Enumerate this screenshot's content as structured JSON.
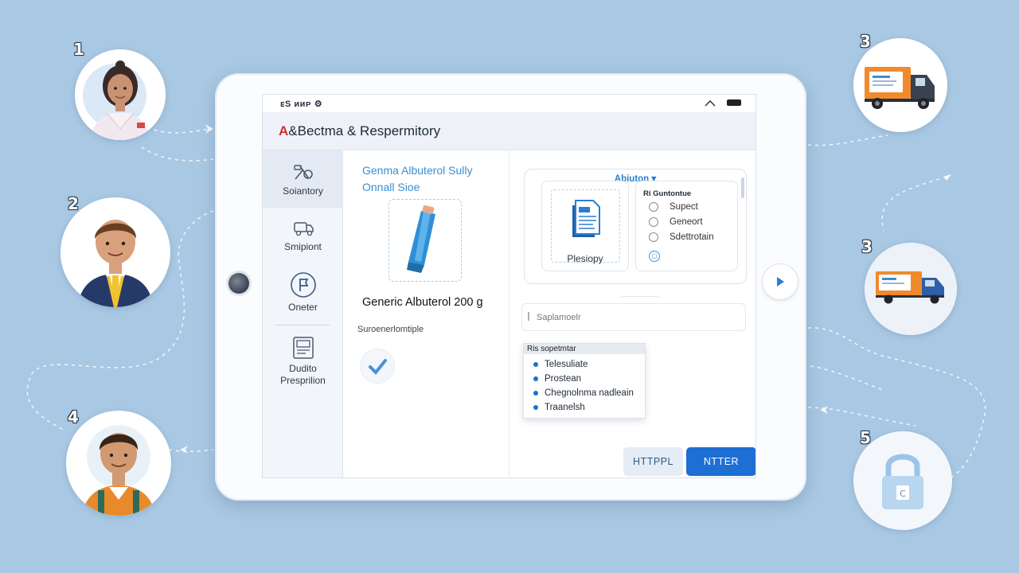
{
  "steps": {
    "s1": "1",
    "s2": "2",
    "s3": "3",
    "s3b": "3",
    "s4": "4",
    "s5": "5"
  },
  "status_bar": {
    "left_text": "ᴇS ᴎᴎᴘ ⚙"
  },
  "app": {
    "title_logo": "A",
    "title_rest": "&Bectma & Respermitory"
  },
  "sidebar": {
    "items": [
      {
        "label": "Soiantory",
        "icon": "tools-icon",
        "active": true
      },
      {
        "label": "Smipiont",
        "icon": "truck-icon"
      },
      {
        "label": "Oneter",
        "icon": "flag-icon"
      },
      {
        "label_line1": "Dudito",
        "label_line2": "Presprilion",
        "icon": "prescription-icon"
      }
    ]
  },
  "product": {
    "subtitle_line1": "Genma Albuterol Sully",
    "subtitle_line2": "Onnall Sioe",
    "name": "Generic Albuterol 200 g",
    "subtext": "Suroenerlomtiple"
  },
  "options": {
    "title": "Abiuton",
    "doc_label": "Plesiopy",
    "radio_header": "Ri Guntontue",
    "radio_items": [
      "Supect",
      "Geneort",
      "Sdettrotain"
    ]
  },
  "search": {
    "placeholder": "Saplamoelr"
  },
  "dropdown": {
    "header": "Ris sopetmtar",
    "items": [
      "Telesuliate",
      "Prostean",
      "Chegnolnma nadleain",
      "Traanelsh"
    ]
  },
  "buttons": {
    "secondary": "HTTPPL",
    "primary": "NTTER"
  },
  "colors": {
    "accent": "#1d6fd4",
    "background": "#a9c8e3",
    "logo_red": "#c8322e",
    "link_blue": "#3a8fd0"
  }
}
